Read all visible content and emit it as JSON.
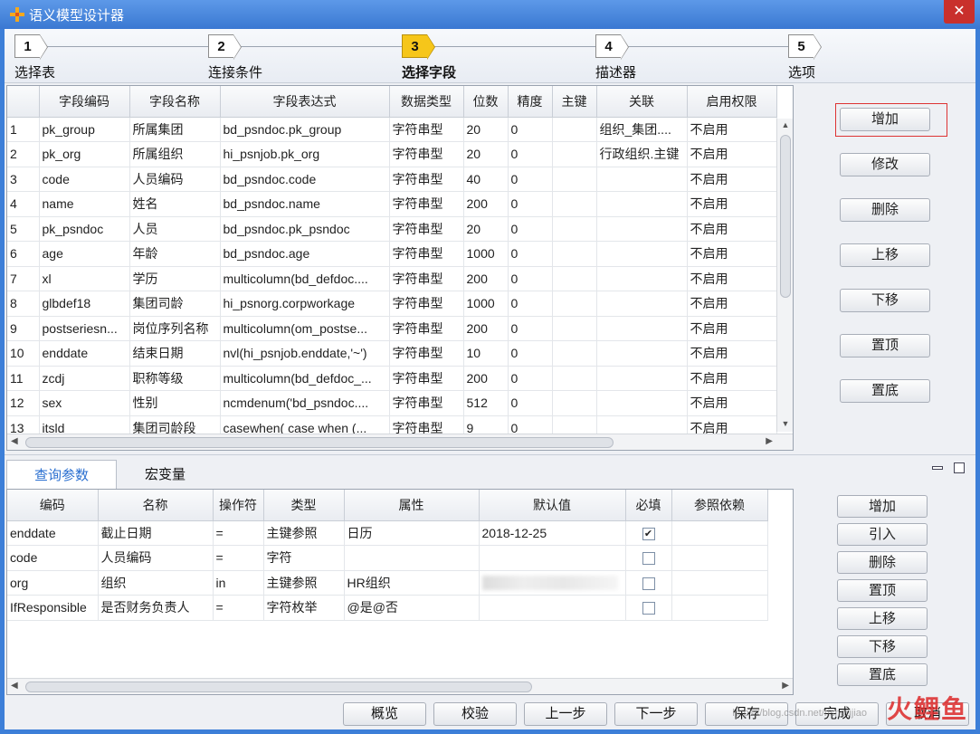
{
  "window": {
    "title": "语义模型设计器",
    "close_glyph": "✕"
  },
  "steps": [
    {
      "num": "1",
      "label": "选择表"
    },
    {
      "num": "2",
      "label": "连接条件"
    },
    {
      "num": "3",
      "label": "选择字段"
    },
    {
      "num": "4",
      "label": "描述器"
    },
    {
      "num": "5",
      "label": "选项"
    }
  ],
  "fields": {
    "columns": [
      "",
      "字段编码",
      "字段名称",
      "字段表达式",
      "数据类型",
      "位数",
      "精度",
      "主键",
      "关联",
      "启用权限"
    ],
    "rows": [
      [
        "1",
        "pk_group",
        "所属集团",
        "bd_psndoc.pk_group",
        "字符串型",
        "20",
        "0",
        "",
        "组织_集团....",
        "不启用"
      ],
      [
        "2",
        "pk_org",
        "所属组织",
        "hi_psnjob.pk_org",
        "字符串型",
        "20",
        "0",
        "",
        "行政组织.主键",
        "不启用"
      ],
      [
        "3",
        "code",
        "人员编码",
        "bd_psndoc.code",
        "字符串型",
        "40",
        "0",
        "",
        "",
        "不启用"
      ],
      [
        "4",
        "name",
        "姓名",
        "bd_psndoc.name",
        "字符串型",
        "200",
        "0",
        "",
        "",
        "不启用"
      ],
      [
        "5",
        "pk_psndoc",
        "人员",
        "bd_psndoc.pk_psndoc",
        "字符串型",
        "20",
        "0",
        "",
        "",
        "不启用"
      ],
      [
        "6",
        "age",
        "年龄",
        "bd_psndoc.age",
        "字符串型",
        "1000",
        "0",
        "",
        "",
        "不启用"
      ],
      [
        "7",
        "xl",
        "学历",
        "multicolumn(bd_defdoc....",
        "字符串型",
        "200",
        "0",
        "",
        "",
        "不启用"
      ],
      [
        "8",
        "glbdef18",
        "集团司龄",
        "hi_psnorg.corpworkage",
        "字符串型",
        "1000",
        "0",
        "",
        "",
        "不启用"
      ],
      [
        "9",
        "postseriesn...",
        "岗位序列名称",
        "multicolumn(om_postse...",
        "字符串型",
        "200",
        "0",
        "",
        "",
        "不启用"
      ],
      [
        "10",
        "enddate",
        "结束日期",
        "nvl(hi_psnjob.enddate,'~')",
        "字符串型",
        "10",
        "0",
        "",
        "",
        "不启用"
      ],
      [
        "11",
        "zcdj",
        "职称等级",
        "multicolumn(bd_defdoc_...",
        "字符串型",
        "200",
        "0",
        "",
        "",
        "不启用"
      ],
      [
        "12",
        "sex",
        "性别",
        "ncmdenum('bd_psndoc....",
        "字符串型",
        "512",
        "0",
        "",
        "",
        "不启用"
      ],
      [
        "13",
        "itsld",
        "集团司龄段",
        "casewhen( case when (...",
        "字符串型",
        "9",
        "0",
        "",
        "",
        "不启用"
      ]
    ]
  },
  "side_buttons": [
    "增加",
    "修改",
    "删除",
    "上移",
    "下移",
    "置顶",
    "置底"
  ],
  "tabs": [
    "查询参数",
    "宏变量"
  ],
  "params": {
    "columns": [
      "编码",
      "名称",
      "操作符",
      "类型",
      "属性",
      "默认值",
      "必填",
      "参照依赖"
    ],
    "rows": [
      {
        "code": "enddate",
        "name": "截止日期",
        "op": "=",
        "type": "主键参照",
        "attr": "日历",
        "default": "2018-12-25",
        "required": true
      },
      {
        "code": "code",
        "name": "人员编码",
        "op": "=",
        "type": "字符",
        "attr": "",
        "default": "",
        "required": false
      },
      {
        "code": "org",
        "name": "组织",
        "op": "in",
        "type": "主键参照",
        "attr": "HR组织",
        "default": "",
        "required": false
      },
      {
        "code": "IfResponsible",
        "name": "是否财务负责人",
        "op": "=",
        "type": "字符枚举",
        "attr": "@是@否",
        "default": "",
        "required": false
      }
    ]
  },
  "param_buttons": [
    "增加",
    "引入",
    "删除",
    "置顶",
    "上移",
    "下移",
    "置底"
  ],
  "bottom_buttons": [
    "概览",
    "校验",
    "上一步",
    "下一步",
    "保存",
    "完成",
    "取消"
  ],
  "watermark": {
    "text": "火鲤鱼",
    "url": "https://blog.csdn.net/rishoujiao"
  },
  "colors": {
    "title_bar": "#3a78d2",
    "active_step": "#f6c61a",
    "highlight": "#dd3333"
  }
}
